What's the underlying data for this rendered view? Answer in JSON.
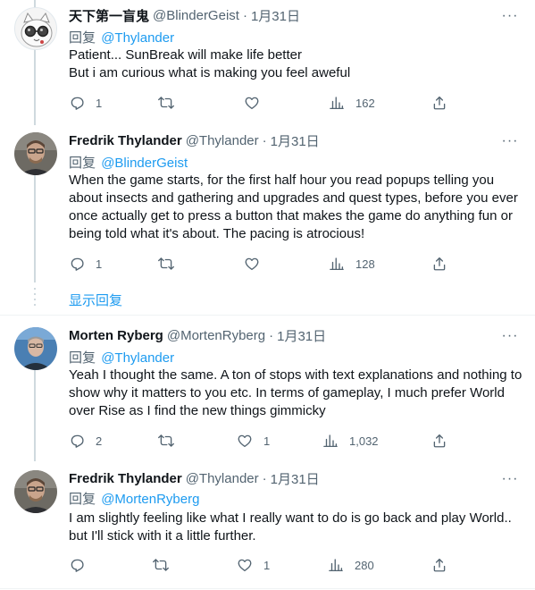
{
  "tweets": [
    {
      "name": "天下第一盲鬼",
      "handle": "@BlinderGeist",
      "dot": "·",
      "date": "1月31日",
      "reply_prefix": "回复",
      "reply_to": "@Thylander",
      "lines": [
        "Patient... SunBreak will make life better",
        "But i am curious what is making you feel aweful"
      ],
      "replies": "1",
      "retweets": "",
      "likes": "",
      "views": "162"
    },
    {
      "name": "Fredrik Thylander",
      "handle": "@Thylander",
      "dot": "·",
      "date": "1月31日",
      "reply_prefix": "回复",
      "reply_to": "@BlinderGeist",
      "lines": [
        "When the game starts, for the first half hour you read popups telling you about insects and gathering and upgrades and quest types, before you ever once actually get to press a button that makes the game do anything fun or being told what it's about. The pacing is atrocious!"
      ],
      "replies": "1",
      "retweets": "",
      "likes": "",
      "views": "128"
    },
    {
      "name": "Morten Ryberg",
      "handle": "@MortenRyberg",
      "dot": "·",
      "date": "1月31日",
      "reply_prefix": "回复",
      "reply_to": "@Thylander",
      "lines": [
        "Yeah I thought the same. A ton of stops with text explanations and nothing to show why it matters to you etc. In terms of gameplay, I much prefer World over Rise as I find the new things gimmicky"
      ],
      "replies": "2",
      "retweets": "",
      "likes": "1",
      "views": "1,032"
    },
    {
      "name": "Fredrik Thylander",
      "handle": "@Thylander",
      "dot": "·",
      "date": "1月31日",
      "reply_prefix": "回复",
      "reply_to": "@MortenRyberg",
      "lines": [
        "I am slightly feeling like what I really want to do is go back and play World.. but I'll stick with it a little further."
      ],
      "replies": "",
      "retweets": "",
      "likes": "1",
      "views": "280"
    }
  ],
  "show_replies": "显示回复",
  "icons": {
    "more": "more-icon",
    "reply": "reply-icon",
    "retweet": "retweet-icon",
    "like": "heart-icon",
    "views": "views-icon",
    "share": "share-icon"
  },
  "colors": {
    "link": "#1d9bf0",
    "muted": "#536471",
    "text": "#0f1419"
  }
}
